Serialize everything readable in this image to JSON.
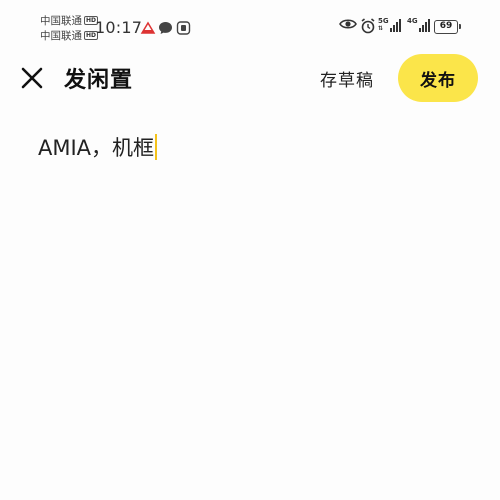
{
  "status_bar": {
    "carrier_1": "中国联通",
    "carrier_2": "中国联通",
    "hd_badge": "HD",
    "time": "10:17",
    "network_1": "5G",
    "network_2": "4G",
    "battery_level": "69",
    "icons": [
      "app-notification-icon",
      "chat-bubble-icon",
      "gift-icon",
      "eye-icon",
      "alarm-icon",
      "signal-icon",
      "battery-icon"
    ]
  },
  "header": {
    "close_icon": "close-icon",
    "title": "发闲置",
    "draft_label": "存草稿",
    "publish_label": "发布"
  },
  "editor": {
    "text": "AMIA，机框"
  },
  "colors": {
    "publish_button": "#fbe54a",
    "caret": "#f5c21b",
    "background": "#fdfdfd"
  }
}
